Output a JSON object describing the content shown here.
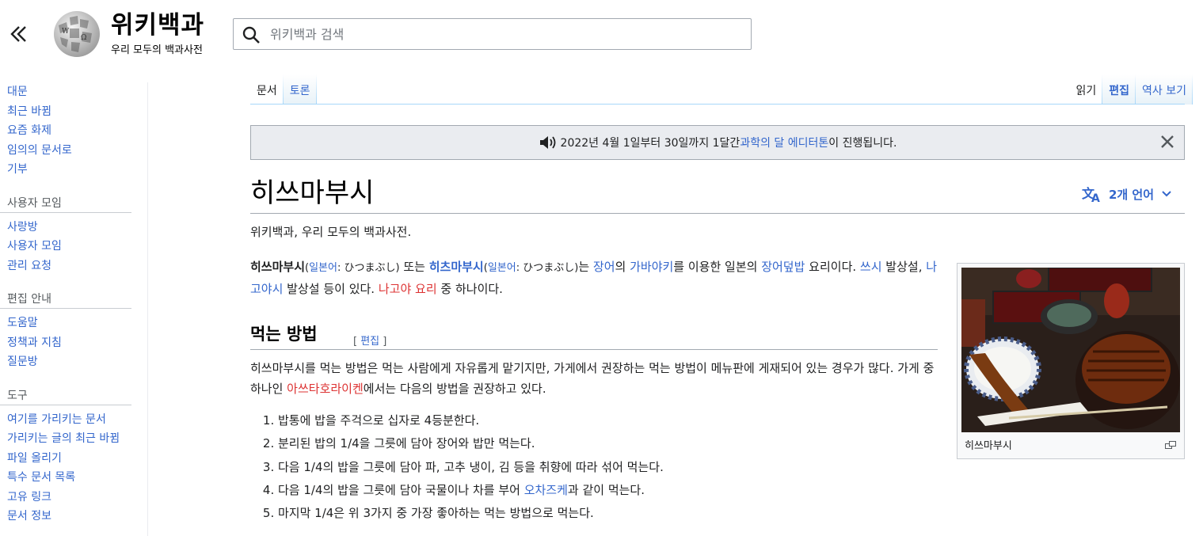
{
  "header": {
    "wordmark": "위키백과",
    "tagline": "우리 모두의 백과사전",
    "search_placeholder": "위키백과 검색"
  },
  "sidebar": {
    "main": [
      "대문",
      "최근 바뀜",
      "요즘 화제",
      "임의의 문서로",
      "기부"
    ],
    "community_heading": "사용자 모임",
    "community": [
      "사랑방",
      "사용자 모임",
      "관리 요청"
    ],
    "help_heading": "편집 안내",
    "help": [
      "도움말",
      "정책과 지침",
      "질문방"
    ],
    "tools_heading": "도구",
    "tools": [
      "여기를 가리키는 문서",
      "가리키는 글의 최근 바뀜",
      "파일 올리기",
      "특수 문서 목록",
      "고유 링크",
      "문서 정보"
    ]
  },
  "tabs": {
    "article": "문서",
    "talk": "토론",
    "read": "읽기",
    "edit": "편집",
    "history": "역사 보기"
  },
  "notice": {
    "prefix": "2022년 4월 1일부터 30일까지 1달간 ",
    "link": "과학의 달 에디터톤",
    "suffix": "이 진행됩니다."
  },
  "article": {
    "title": "히쓰마부시",
    "languages": "2개 언어",
    "site_sub": "위키백과, 우리 모두의 백과사전.",
    "intro": {
      "term1": "히쓰마부시",
      "lang_label": "일본어",
      "kana": "ひつまぶし",
      "or": " 또는 ",
      "term2": "히츠마부시",
      "is": "는 ",
      "eel": "장어",
      "of": "의 ",
      "kabayaki": "가바야키",
      "using": "를 이용한 일본의 ",
      "unadon": "장어덮밥",
      "dish": " 요리이다. ",
      "tsu": "쓰시",
      "origin1": " 발상설, ",
      "nagoya": "나고야시",
      "origin2": " 발상설 등이 있다. ",
      "nagoya_cuisine": "나고야 요리",
      "one_of": " 중 하나이다."
    },
    "section": {
      "heading": "먹는 방법",
      "edit": "편집",
      "para_a": "히쓰마부시를 먹는 방법은 먹는 사람에게 자유롭게 맡기지만, 가게에서 권장하는 먹는 방법이 메뉴판에 게재되어 있는 경우가 많다. 가게 중 하나인 ",
      "restaurant": "아쓰타호라이켄",
      "para_b": "에서는 다음의 방법을 권장하고 있다.",
      "steps": [
        "밥통에 밥을 주걱으로 십자로 4등분한다.",
        "분리된 밥의 1/4을 그릇에 담아 장어와 밥만 먹는다.",
        "다음 1/4의 밥을 그릇에 담아 파, 고추 냉이, 김 등을 취향에 따라 섞어 먹는다.",
        "다음 1/4의 밥을 그릇에 담아 국물이나 차를 부어 ",
        "마지막 1/4은 위 3가지 중 가장 좋아하는 먹는 방법으로 먹는다."
      ],
      "ochazuke": "오차즈케",
      "step4_end": "과 같이 먹는다."
    },
    "figure_caption": "히쓰마부시"
  },
  "colors": {
    "link": "#3366cc",
    "redlink": "#dd3333",
    "tab_border": "#a7d7f9"
  }
}
